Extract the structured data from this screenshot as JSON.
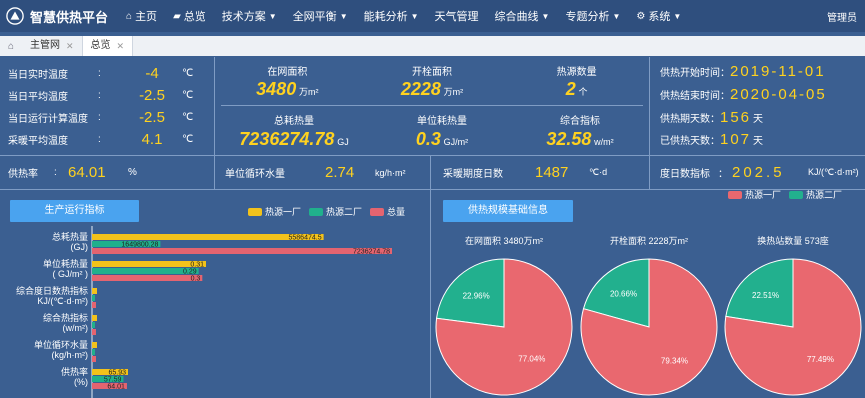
{
  "app": {
    "title": "智慧供热平台"
  },
  "nav": {
    "items": [
      {
        "label": "主页",
        "icon": "home-icon"
      },
      {
        "label": "总览",
        "icon": "chat-icon"
      },
      {
        "label": "技术方案",
        "caret": true
      },
      {
        "label": "全网平衡",
        "caret": true
      },
      {
        "label": "能耗分析",
        "caret": true
      },
      {
        "label": "天气管理"
      },
      {
        "label": "综合曲线",
        "caret": true
      },
      {
        "label": "专题分析",
        "caret": true
      },
      {
        "label": "系统",
        "icon": "gear-icon",
        "caret": true
      }
    ],
    "user": "管理员"
  },
  "tabs": [
    {
      "label": "主管网"
    },
    {
      "label": "总览",
      "active": true
    }
  ],
  "temps": [
    {
      "label": "当日实时温度",
      "value": "-4",
      "unit": "℃"
    },
    {
      "label": "当日平均温度",
      "value": "-2.5",
      "unit": "℃"
    },
    {
      "label": "当日运行计算温度",
      "value": "-2.5",
      "unit": "℃"
    },
    {
      "label": "采暖平均温度",
      "value": "4.1",
      "unit": "℃"
    }
  ],
  "heat_rate": {
    "label": "供热率",
    "value": "64.01",
    "unit": "%"
  },
  "center_stats": {
    "row1": [
      {
        "label": "在网面积",
        "value": "3480",
        "unit": "万m²"
      },
      {
        "label": "开栓面积",
        "value": "2228",
        "unit": "万m²"
      },
      {
        "label": "热源数量",
        "value": "2",
        "unit": "个"
      }
    ],
    "row2": [
      {
        "label": "总耗热量",
        "value": "7236274.78",
        "unit": "GJ"
      },
      {
        "label": "单位耗热量",
        "value": "0.3",
        "unit": "GJ/m²"
      },
      {
        "label": "综合指标",
        "value": "32.58",
        "unit": "w/m²"
      }
    ]
  },
  "water": {
    "label": "单位循环水量",
    "value": "2.74",
    "unit": "kg/h·m²"
  },
  "degree_days": {
    "label": "采暖期度日数",
    "value": "1487",
    "unit": "℃·d"
  },
  "season": [
    {
      "label": "供热开始时间",
      "value": "2019-11-01"
    },
    {
      "label": "供热结束时间",
      "value": "2020-04-05"
    },
    {
      "label": "供热期天数",
      "value": "156",
      "unit": "天"
    },
    {
      "label": "已供热天数",
      "value": "107",
      "unit": "天"
    }
  ],
  "degree_index": {
    "label": "度日数指标",
    "value": "202.5",
    "unit": "KJ/(℃·d·m²)"
  },
  "buttons": {
    "production": "生产运行指标",
    "scale": "供热规模基础信息"
  },
  "colors": {
    "source1": "#f2c21b",
    "source2": "#20b08c",
    "total": "#e46470",
    "pie1": "#e9686f",
    "pie2": "#22b08e"
  },
  "chart_data": [
    {
      "type": "bar",
      "orientation": "horizontal",
      "categories": [
        "总耗热量\n(GJ)",
        "单位耗热量\n( GJ/m² )",
        "综合度日数热指标\nKJ/(℃·d·m²)",
        "综合热指标\n(w/m²)",
        "单位循环水量\n(kg/h·m²)",
        "供热率\n(%)"
      ],
      "series": [
        {
          "name": "热源一厂",
          "values": [
            5586474.5,
            0.31,
            null,
            null,
            null,
            65.93
          ],
          "labels": [
            "5586474.5",
            "0.31",
            "",
            "",
            "",
            "65.93"
          ]
        },
        {
          "name": "热源二厂",
          "values": [
            1649800.28,
            0.29,
            null,
            null,
            null,
            57.59
          ],
          "labels": [
            "1649800.28",
            "0.29",
            "",
            "",
            "",
            "57.59"
          ]
        },
        {
          "name": "总量",
          "values": [
            7236274.78,
            0.3,
            null,
            null,
            null,
            64.01
          ],
          "labels": [
            "7236274.78",
            "0.3",
            "",
            "",
            "",
            "64.01"
          ]
        }
      ]
    },
    {
      "type": "pie",
      "charts": [
        {
          "title": "在网面积 3480万m²",
          "slices": [
            {
              "name": "热源一厂",
              "value": 77.04,
              "label": "77.04%"
            },
            {
              "name": "热源二厂",
              "value": 22.96,
              "label": "22.96%"
            }
          ]
        },
        {
          "title": "开栓面积 2228万m²",
          "slices": [
            {
              "name": "热源一厂",
              "value": 79.34,
              "label": "79.34%"
            },
            {
              "name": "热源二厂",
              "value": 20.66,
              "label": "20.66%"
            }
          ]
        },
        {
          "title": "换热站数量 573座",
          "slices": [
            {
              "name": "热源一厂",
              "value": 77.49,
              "label": "77.49%"
            },
            {
              "name": "热源二厂",
              "value": 22.51,
              "label": "22.51%"
            }
          ]
        }
      ],
      "legend": [
        "热源一厂",
        "热源二厂"
      ]
    }
  ]
}
